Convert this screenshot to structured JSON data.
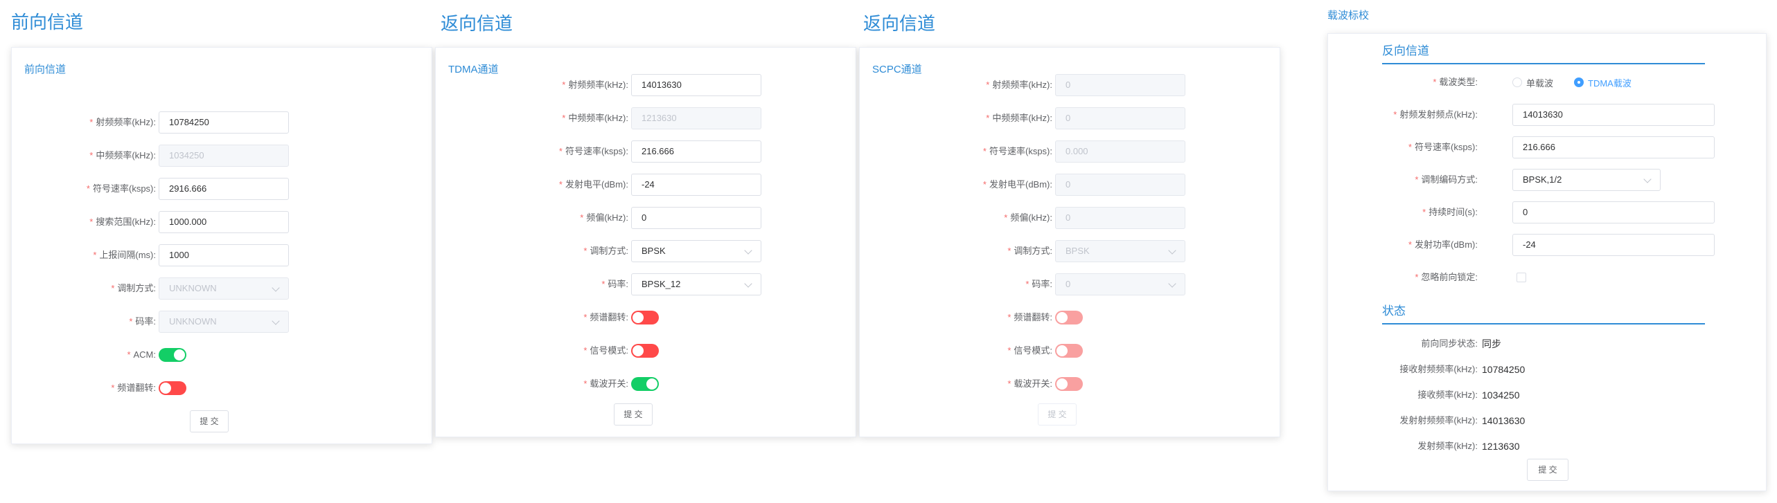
{
  "colors": {
    "accent": "#2f8cd6",
    "switch_on": "#13ce66",
    "switch_off": "#ff4949",
    "switch_off_disabled": "#f9a0a0",
    "radio_checked": "#409eff",
    "required": "#f56c6c"
  },
  "sections": {
    "forward": "前向信道",
    "return1": "返向信道",
    "return2": "返向信道",
    "calib": "载波标校"
  },
  "forward": {
    "card_title": "前向信道",
    "fields": [
      {
        "label": "射频频率(kHz):",
        "value": "10784250"
      },
      {
        "label": "中频频率(kHz):",
        "value": "1034250"
      },
      {
        "label": "符号速率(ksps):",
        "value": "2916.666"
      },
      {
        "label": "搜索范围(kHz):",
        "value": "1000.000"
      },
      {
        "label": "上报间隔(ms):",
        "value": "1000"
      },
      {
        "label": "调制方式:",
        "value": "UNKNOWN"
      },
      {
        "label": "码率:",
        "value": "UNKNOWN"
      },
      {
        "label": "ACM:",
        "value": "on"
      },
      {
        "label": "频谱翻转:",
        "value": "off"
      }
    ],
    "submit": "提 交"
  },
  "tdma": {
    "card_title": "TDMA通道",
    "fields": [
      {
        "label": "射频频率(kHz):",
        "value": "14013630"
      },
      {
        "label": "中频频率(kHz):",
        "value": "1213630"
      },
      {
        "label": "符号速率(ksps):",
        "value": "216.666"
      },
      {
        "label": "发射电平(dBm):",
        "value": "-24"
      },
      {
        "label": "频偏(kHz):",
        "value": "0"
      },
      {
        "label": "调制方式:",
        "value": "BPSK"
      },
      {
        "label": "码率:",
        "value": "BPSK_12"
      },
      {
        "label": "频谱翻转:",
        "value": "off"
      },
      {
        "label": "信号模式:",
        "value": "off"
      },
      {
        "label": "载波开关:",
        "value": "on"
      }
    ],
    "submit": "提 交"
  },
  "scpc": {
    "card_title": "SCPC通道",
    "fields": [
      {
        "label": "射频频率(kHz):",
        "value": "0"
      },
      {
        "label": "中频频率(kHz):",
        "value": "0"
      },
      {
        "label": "符号速率(ksps):",
        "value": "0.000"
      },
      {
        "label": "发射电平(dBm):",
        "value": "0"
      },
      {
        "label": "频偏(kHz):",
        "value": "0"
      },
      {
        "label": "调制方式:",
        "value": "BPSK"
      },
      {
        "label": "码率:",
        "value": "0"
      },
      {
        "label": "频谱翻转:",
        "value": "off"
      },
      {
        "label": "信号模式:",
        "value": "off"
      },
      {
        "label": "载波开关:",
        "value": "off"
      }
    ],
    "submit": "提 交"
  },
  "calib": {
    "reverse_head": "反向信道",
    "carrier_type_label": "载波类型:",
    "carrier_options": [
      "单载波",
      "TDMA载波"
    ],
    "carrier_selected": "TDMA载波",
    "fields": [
      {
        "label": "射频发射频点(kHz):",
        "value": "14013630"
      },
      {
        "label": "符号速率(ksps):",
        "value": "216.666"
      },
      {
        "label": "调制编码方式:",
        "value": "BPSK,1/2"
      },
      {
        "label": "持续时间(s):",
        "value": "0"
      },
      {
        "label": "发射功率(dBm):",
        "value": "-24"
      }
    ],
    "ignore_lock_label": "忽略前向锁定:",
    "status_head": "状态",
    "status": [
      {
        "label": "前向同步状态:",
        "value": "同步"
      },
      {
        "label": "接收射频频率(kHz):",
        "value": "10784250"
      },
      {
        "label": "接收频率(kHz):",
        "value": "1034250"
      },
      {
        "label": "发射射频频率(kHz):",
        "value": "14013630"
      },
      {
        "label": "发射频率(kHz):",
        "value": "1213630"
      }
    ],
    "submit": "提 交"
  }
}
